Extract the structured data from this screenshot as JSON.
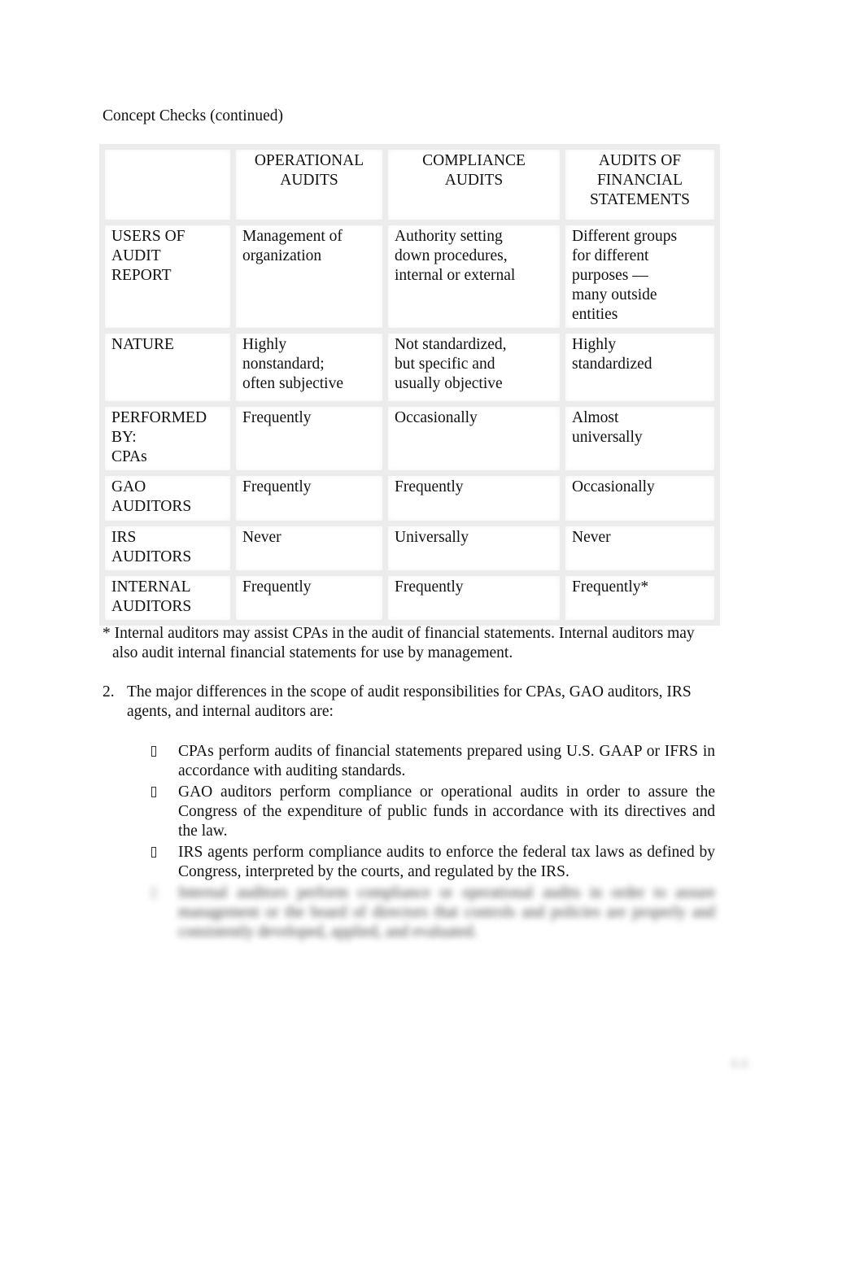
{
  "page": {
    "title": "Concept Checks (continued)",
    "page_number": "1-1"
  },
  "table": {
    "headers": [
      "",
      "OPERATIONAL\nAUDITS",
      "COMPLIANCE\nAUDITS",
      "AUDITS OF\nFINANCIAL\nSTATEMENTS"
    ],
    "rows": [
      {
        "label": "USERS OF\nAUDIT\nREPORT",
        "cells": [
          "Management of\norganization",
          "Authority setting\ndown procedures,\ninternal or external",
          "Different groups\nfor different\npurposes —\nmany outside\nentities"
        ]
      },
      {
        "label": "NATURE",
        "cells": [
          "Highly\nnonstandard;\noften subjective",
          "Not standardized,\nbut specific and\nusually objective",
          "Highly\nstandardized"
        ]
      },
      {
        "label": "PERFORMED\nBY:\nCPAs",
        "cells": [
          "Frequently",
          "Occasionally",
          "Almost\nuniversally"
        ]
      },
      {
        "label": "GAO\nAUDITORS",
        "cells": [
          "Frequently",
          "Frequently",
          "Occasionally"
        ]
      },
      {
        "label": "IRS\nAUDITORS",
        "cells": [
          "Never",
          "Universally",
          "Never"
        ]
      },
      {
        "label": "INTERNAL\nAUDITORS",
        "cells": [
          "Frequently",
          "Frequently",
          "Frequently*"
        ]
      }
    ]
  },
  "footnote": "* Internal auditors may assist CPAs in the audit of financial statements. Internal auditors may also audit internal financial statements for use by management.",
  "question2": {
    "number": "2.",
    "text": "The major differences in the scope of audit responsibilities for CPAs, GAO auditors, IRS agents, and internal auditors are:",
    "bullets": [
      "CPAs perform audits of financial statements prepared using U.S. GAAP or IFRS in accordance with auditing standards.",
      "GAO auditors perform compliance or operational audits in order to assure the Congress of the expenditure of public funds in accordance with its directives and the law.",
      "IRS agents perform compliance audits to enforce the federal tax laws as defined by Congress, interpreted by the courts, and regulated by the IRS.",
      "Internal auditors perform compliance or operational audits in order to assure management or the board of directors that controls and policies are properly and consistently developed, applied, and evaluated."
    ]
  }
}
